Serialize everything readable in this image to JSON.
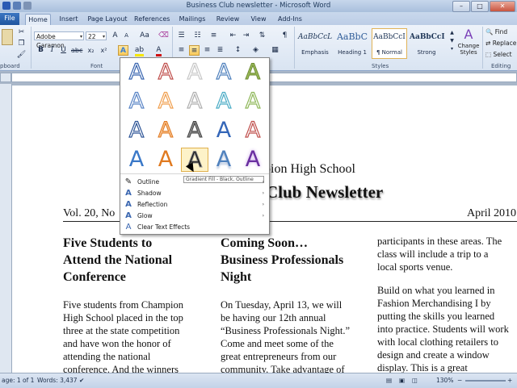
{
  "window": {
    "title": "Business Club newsletter - Microsoft Word",
    "buttons": [
      "–",
      "□",
      "✕"
    ]
  },
  "tabs": [
    "File",
    "Home",
    "Insert",
    "Page Layout",
    "References",
    "Mailings",
    "Review",
    "View",
    "Add-Ins"
  ],
  "ribbon": {
    "font_name": "Adobe Garamon",
    "font_size": "22",
    "group_clipboard": "pboard",
    "group_font": "Font",
    "group_styles": "Styles",
    "group_editing": "Editing",
    "styles": [
      {
        "sample": "AaBbCcL",
        "name": "Emphasis"
      },
      {
        "sample": "AaBbC",
        "name": "Heading 1"
      },
      {
        "sample": "AaBbCcI",
        "name": "¶ Normal"
      },
      {
        "sample": "AaBbCcI",
        "name": "Strong"
      }
    ],
    "change_styles": "Change Styles",
    "find": "Find",
    "replace": "Replace",
    "select": "Select"
  },
  "gallery": {
    "glyph": "A",
    "tooltip": "Gradient Fill - Black, Outline",
    "menu": [
      {
        "label": "Outline",
        "arrow": "›"
      },
      {
        "label": "Shadow",
        "arrow": "›"
      },
      {
        "label": "Reflection",
        "arrow": "›"
      },
      {
        "label": "Glow",
        "arrow": "›"
      },
      {
        "label": "Clear Text Effects",
        "arrow": ""
      }
    ]
  },
  "document": {
    "school_name": "pion High School",
    "newsletter_title": "Club Newsletter",
    "volume": "Vol. 20, No",
    "date": "April 2010",
    "col1_heading": [
      "Five Students to",
      "Attend the National",
      "Conference"
    ],
    "col1_body": [
      "Five students from Champion",
      "High School placed in the top",
      "three at the state competition",
      "and have won the honor of",
      "attending the national",
      "conference. And the winners"
    ],
    "col2_heading": [
      "Coming Soon…",
      "Business Professionals",
      "Night"
    ],
    "col2_body": [
      "On Tuesday, April 13, we will",
      "be having our 12th annual",
      "“Business Professionals Night.”",
      "Come and meet some of the",
      "great entrepreneurs from our",
      "community. Take advantage of"
    ],
    "col3_body1": [
      "participants in these areas. The",
      "class will include a trip to a",
      "local sports venue."
    ],
    "col3_body2": [
      "Build on what you learned in",
      "Fashion Merchandising I by",
      "putting the skills you learned",
      "into practice. Students will work",
      "with local clothing retailers to",
      "design and create a window",
      "display. This is a great"
    ]
  },
  "status": {
    "page": "age: 1 of 1",
    "words": "Words: 3,437",
    "zoom": "130%"
  }
}
